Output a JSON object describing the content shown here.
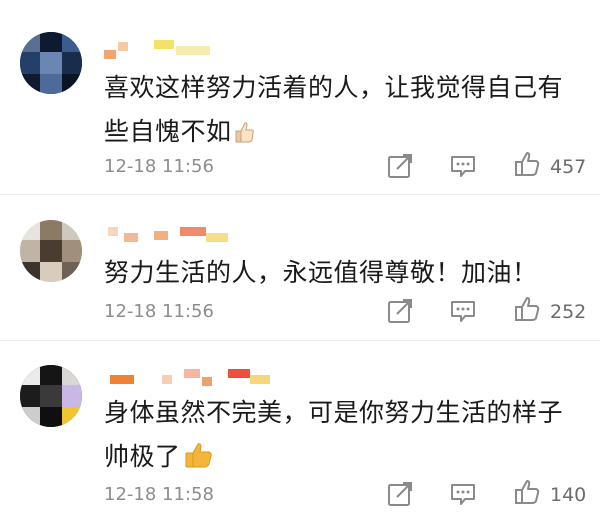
{
  "comments": [
    {
      "text": "喜欢这样努力活着的人，让我觉得自己有些自愧不如",
      "time": "12-18 11:56",
      "likes": "457"
    },
    {
      "text": "努力生活的人，永远值得尊敬！加油！",
      "time": "12-18 11:56",
      "likes": "252"
    },
    {
      "text": "身体虽然不完美，可是你努力生活的样子帅极了",
      "time": "12-18 11:58",
      "likes": "140"
    }
  ],
  "icons": {
    "share": "share-icon",
    "reply": "comment-icon",
    "like": "thumbs-up-icon",
    "emoji": "thumbs-up-emoji-icon"
  },
  "colors": {
    "text": "#1a1a1a",
    "meta": "#8d8d8d",
    "icon": "#8a8a8a",
    "divider": "#ececec",
    "emoji": "#f4b63a"
  }
}
